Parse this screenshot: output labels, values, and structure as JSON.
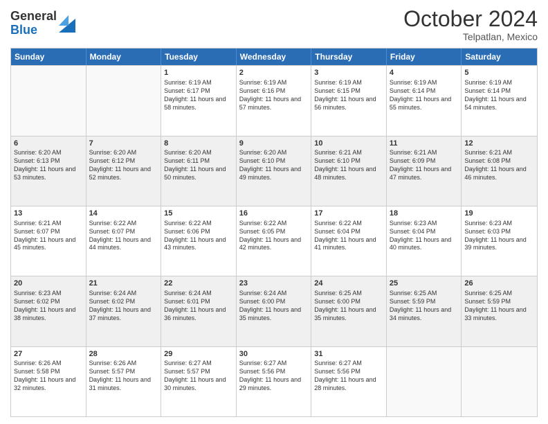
{
  "logo": {
    "general": "General",
    "blue": "Blue"
  },
  "title": "October 2024",
  "location": "Telpatlan, Mexico",
  "days": [
    "Sunday",
    "Monday",
    "Tuesday",
    "Wednesday",
    "Thursday",
    "Friday",
    "Saturday"
  ],
  "weeks": [
    [
      {
        "day": "",
        "sunrise": "",
        "sunset": "",
        "daylight": "",
        "empty": true
      },
      {
        "day": "",
        "sunrise": "",
        "sunset": "",
        "daylight": "",
        "empty": true
      },
      {
        "day": "1",
        "sunrise": "Sunrise: 6:19 AM",
        "sunset": "Sunset: 6:17 PM",
        "daylight": "Daylight: 11 hours and 58 minutes."
      },
      {
        "day": "2",
        "sunrise": "Sunrise: 6:19 AM",
        "sunset": "Sunset: 6:16 PM",
        "daylight": "Daylight: 11 hours and 57 minutes."
      },
      {
        "day": "3",
        "sunrise": "Sunrise: 6:19 AM",
        "sunset": "Sunset: 6:15 PM",
        "daylight": "Daylight: 11 hours and 56 minutes."
      },
      {
        "day": "4",
        "sunrise": "Sunrise: 6:19 AM",
        "sunset": "Sunset: 6:14 PM",
        "daylight": "Daylight: 11 hours and 55 minutes."
      },
      {
        "day": "5",
        "sunrise": "Sunrise: 6:19 AM",
        "sunset": "Sunset: 6:14 PM",
        "daylight": "Daylight: 11 hours and 54 minutes."
      }
    ],
    [
      {
        "day": "6",
        "sunrise": "Sunrise: 6:20 AM",
        "sunset": "Sunset: 6:13 PM",
        "daylight": "Daylight: 11 hours and 53 minutes."
      },
      {
        "day": "7",
        "sunrise": "Sunrise: 6:20 AM",
        "sunset": "Sunset: 6:12 PM",
        "daylight": "Daylight: 11 hours and 52 minutes."
      },
      {
        "day": "8",
        "sunrise": "Sunrise: 6:20 AM",
        "sunset": "Sunset: 6:11 PM",
        "daylight": "Daylight: 11 hours and 50 minutes."
      },
      {
        "day": "9",
        "sunrise": "Sunrise: 6:20 AM",
        "sunset": "Sunset: 6:10 PM",
        "daylight": "Daylight: 11 hours and 49 minutes."
      },
      {
        "day": "10",
        "sunrise": "Sunrise: 6:21 AM",
        "sunset": "Sunset: 6:10 PM",
        "daylight": "Daylight: 11 hours and 48 minutes."
      },
      {
        "day": "11",
        "sunrise": "Sunrise: 6:21 AM",
        "sunset": "Sunset: 6:09 PM",
        "daylight": "Daylight: 11 hours and 47 minutes."
      },
      {
        "day": "12",
        "sunrise": "Sunrise: 6:21 AM",
        "sunset": "Sunset: 6:08 PM",
        "daylight": "Daylight: 11 hours and 46 minutes."
      }
    ],
    [
      {
        "day": "13",
        "sunrise": "Sunrise: 6:21 AM",
        "sunset": "Sunset: 6:07 PM",
        "daylight": "Daylight: 11 hours and 45 minutes."
      },
      {
        "day": "14",
        "sunrise": "Sunrise: 6:22 AM",
        "sunset": "Sunset: 6:07 PM",
        "daylight": "Daylight: 11 hours and 44 minutes."
      },
      {
        "day": "15",
        "sunrise": "Sunrise: 6:22 AM",
        "sunset": "Sunset: 6:06 PM",
        "daylight": "Daylight: 11 hours and 43 minutes."
      },
      {
        "day": "16",
        "sunrise": "Sunrise: 6:22 AM",
        "sunset": "Sunset: 6:05 PM",
        "daylight": "Daylight: 11 hours and 42 minutes."
      },
      {
        "day": "17",
        "sunrise": "Sunrise: 6:22 AM",
        "sunset": "Sunset: 6:04 PM",
        "daylight": "Daylight: 11 hours and 41 minutes."
      },
      {
        "day": "18",
        "sunrise": "Sunrise: 6:23 AM",
        "sunset": "Sunset: 6:04 PM",
        "daylight": "Daylight: 11 hours and 40 minutes."
      },
      {
        "day": "19",
        "sunrise": "Sunrise: 6:23 AM",
        "sunset": "Sunset: 6:03 PM",
        "daylight": "Daylight: 11 hours and 39 minutes."
      }
    ],
    [
      {
        "day": "20",
        "sunrise": "Sunrise: 6:23 AM",
        "sunset": "Sunset: 6:02 PM",
        "daylight": "Daylight: 11 hours and 38 minutes."
      },
      {
        "day": "21",
        "sunrise": "Sunrise: 6:24 AM",
        "sunset": "Sunset: 6:02 PM",
        "daylight": "Daylight: 11 hours and 37 minutes."
      },
      {
        "day": "22",
        "sunrise": "Sunrise: 6:24 AM",
        "sunset": "Sunset: 6:01 PM",
        "daylight": "Daylight: 11 hours and 36 minutes."
      },
      {
        "day": "23",
        "sunrise": "Sunrise: 6:24 AM",
        "sunset": "Sunset: 6:00 PM",
        "daylight": "Daylight: 11 hours and 35 minutes."
      },
      {
        "day": "24",
        "sunrise": "Sunrise: 6:25 AM",
        "sunset": "Sunset: 6:00 PM",
        "daylight": "Daylight: 11 hours and 35 minutes."
      },
      {
        "day": "25",
        "sunrise": "Sunrise: 6:25 AM",
        "sunset": "Sunset: 5:59 PM",
        "daylight": "Daylight: 11 hours and 34 minutes."
      },
      {
        "day": "26",
        "sunrise": "Sunrise: 6:25 AM",
        "sunset": "Sunset: 5:59 PM",
        "daylight": "Daylight: 11 hours and 33 minutes."
      }
    ],
    [
      {
        "day": "27",
        "sunrise": "Sunrise: 6:26 AM",
        "sunset": "Sunset: 5:58 PM",
        "daylight": "Daylight: 11 hours and 32 minutes."
      },
      {
        "day": "28",
        "sunrise": "Sunrise: 6:26 AM",
        "sunset": "Sunset: 5:57 PM",
        "daylight": "Daylight: 11 hours and 31 minutes."
      },
      {
        "day": "29",
        "sunrise": "Sunrise: 6:27 AM",
        "sunset": "Sunset: 5:57 PM",
        "daylight": "Daylight: 11 hours and 30 minutes."
      },
      {
        "day": "30",
        "sunrise": "Sunrise: 6:27 AM",
        "sunset": "Sunset: 5:56 PM",
        "daylight": "Daylight: 11 hours and 29 minutes."
      },
      {
        "day": "31",
        "sunrise": "Sunrise: 6:27 AM",
        "sunset": "Sunset: 5:56 PM",
        "daylight": "Daylight: 11 hours and 28 minutes."
      },
      {
        "day": "",
        "sunrise": "",
        "sunset": "",
        "daylight": "",
        "empty": true
      },
      {
        "day": "",
        "sunrise": "",
        "sunset": "",
        "daylight": "",
        "empty": true
      }
    ]
  ]
}
